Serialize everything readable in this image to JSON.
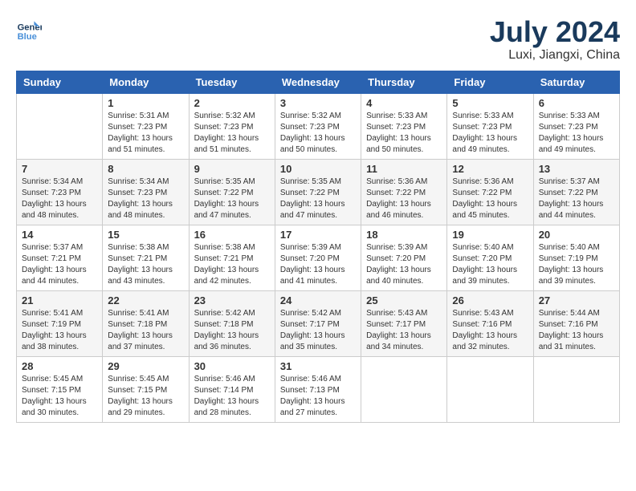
{
  "header": {
    "logo_line1": "General",
    "logo_line2": "Blue",
    "title": "July 2024",
    "subtitle": "Luxi, Jiangxi, China"
  },
  "days_of_week": [
    "Sunday",
    "Monday",
    "Tuesday",
    "Wednesday",
    "Thursday",
    "Friday",
    "Saturday"
  ],
  "weeks": [
    [
      {
        "day": "",
        "info": ""
      },
      {
        "day": "1",
        "info": "Sunrise: 5:31 AM\nSunset: 7:23 PM\nDaylight: 13 hours\nand 51 minutes."
      },
      {
        "day": "2",
        "info": "Sunrise: 5:32 AM\nSunset: 7:23 PM\nDaylight: 13 hours\nand 51 minutes."
      },
      {
        "day": "3",
        "info": "Sunrise: 5:32 AM\nSunset: 7:23 PM\nDaylight: 13 hours\nand 50 minutes."
      },
      {
        "day": "4",
        "info": "Sunrise: 5:33 AM\nSunset: 7:23 PM\nDaylight: 13 hours\nand 50 minutes."
      },
      {
        "day": "5",
        "info": "Sunrise: 5:33 AM\nSunset: 7:23 PM\nDaylight: 13 hours\nand 49 minutes."
      },
      {
        "day": "6",
        "info": "Sunrise: 5:33 AM\nSunset: 7:23 PM\nDaylight: 13 hours\nand 49 minutes."
      }
    ],
    [
      {
        "day": "7",
        "info": "Sunrise: 5:34 AM\nSunset: 7:23 PM\nDaylight: 13 hours\nand 48 minutes."
      },
      {
        "day": "8",
        "info": "Sunrise: 5:34 AM\nSunset: 7:23 PM\nDaylight: 13 hours\nand 48 minutes."
      },
      {
        "day": "9",
        "info": "Sunrise: 5:35 AM\nSunset: 7:22 PM\nDaylight: 13 hours\nand 47 minutes."
      },
      {
        "day": "10",
        "info": "Sunrise: 5:35 AM\nSunset: 7:22 PM\nDaylight: 13 hours\nand 47 minutes."
      },
      {
        "day": "11",
        "info": "Sunrise: 5:36 AM\nSunset: 7:22 PM\nDaylight: 13 hours\nand 46 minutes."
      },
      {
        "day": "12",
        "info": "Sunrise: 5:36 AM\nSunset: 7:22 PM\nDaylight: 13 hours\nand 45 minutes."
      },
      {
        "day": "13",
        "info": "Sunrise: 5:37 AM\nSunset: 7:22 PM\nDaylight: 13 hours\nand 44 minutes."
      }
    ],
    [
      {
        "day": "14",
        "info": "Sunrise: 5:37 AM\nSunset: 7:21 PM\nDaylight: 13 hours\nand 44 minutes."
      },
      {
        "day": "15",
        "info": "Sunrise: 5:38 AM\nSunset: 7:21 PM\nDaylight: 13 hours\nand 43 minutes."
      },
      {
        "day": "16",
        "info": "Sunrise: 5:38 AM\nSunset: 7:21 PM\nDaylight: 13 hours\nand 42 minutes."
      },
      {
        "day": "17",
        "info": "Sunrise: 5:39 AM\nSunset: 7:20 PM\nDaylight: 13 hours\nand 41 minutes."
      },
      {
        "day": "18",
        "info": "Sunrise: 5:39 AM\nSunset: 7:20 PM\nDaylight: 13 hours\nand 40 minutes."
      },
      {
        "day": "19",
        "info": "Sunrise: 5:40 AM\nSunset: 7:20 PM\nDaylight: 13 hours\nand 39 minutes."
      },
      {
        "day": "20",
        "info": "Sunrise: 5:40 AM\nSunset: 7:19 PM\nDaylight: 13 hours\nand 39 minutes."
      }
    ],
    [
      {
        "day": "21",
        "info": "Sunrise: 5:41 AM\nSunset: 7:19 PM\nDaylight: 13 hours\nand 38 minutes."
      },
      {
        "day": "22",
        "info": "Sunrise: 5:41 AM\nSunset: 7:18 PM\nDaylight: 13 hours\nand 37 minutes."
      },
      {
        "day": "23",
        "info": "Sunrise: 5:42 AM\nSunset: 7:18 PM\nDaylight: 13 hours\nand 36 minutes."
      },
      {
        "day": "24",
        "info": "Sunrise: 5:42 AM\nSunset: 7:17 PM\nDaylight: 13 hours\nand 35 minutes."
      },
      {
        "day": "25",
        "info": "Sunrise: 5:43 AM\nSunset: 7:17 PM\nDaylight: 13 hours\nand 34 minutes."
      },
      {
        "day": "26",
        "info": "Sunrise: 5:43 AM\nSunset: 7:16 PM\nDaylight: 13 hours\nand 32 minutes."
      },
      {
        "day": "27",
        "info": "Sunrise: 5:44 AM\nSunset: 7:16 PM\nDaylight: 13 hours\nand 31 minutes."
      }
    ],
    [
      {
        "day": "28",
        "info": "Sunrise: 5:45 AM\nSunset: 7:15 PM\nDaylight: 13 hours\nand 30 minutes."
      },
      {
        "day": "29",
        "info": "Sunrise: 5:45 AM\nSunset: 7:15 PM\nDaylight: 13 hours\nand 29 minutes."
      },
      {
        "day": "30",
        "info": "Sunrise: 5:46 AM\nSunset: 7:14 PM\nDaylight: 13 hours\nand 28 minutes."
      },
      {
        "day": "31",
        "info": "Sunrise: 5:46 AM\nSunset: 7:13 PM\nDaylight: 13 hours\nand 27 minutes."
      },
      {
        "day": "",
        "info": ""
      },
      {
        "day": "",
        "info": ""
      },
      {
        "day": "",
        "info": ""
      }
    ]
  ]
}
